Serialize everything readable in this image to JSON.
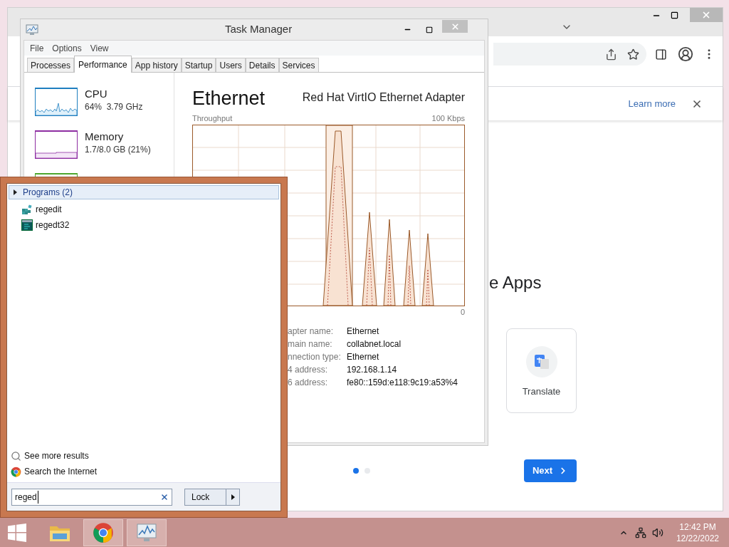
{
  "browser": {
    "infobar": {
      "link": "Learn more"
    },
    "heading": "e Apps",
    "app_card": {
      "label": "Translate"
    },
    "pager": [
      {
        "selected": true
      },
      {
        "selected": false
      }
    ],
    "next_button": "Next"
  },
  "task_manager": {
    "title": "Task Manager",
    "menu": [
      "File",
      "Options",
      "View"
    ],
    "tabs": [
      {
        "label": "Processes",
        "selected": false
      },
      {
        "label": "Performance",
        "selected": true
      },
      {
        "label": "App history",
        "selected": false
      },
      {
        "label": "Startup",
        "selected": false
      },
      {
        "label": "Users",
        "selected": false
      },
      {
        "label": "Details",
        "selected": false
      },
      {
        "label": "Services",
        "selected": false
      }
    ],
    "resources": [
      {
        "kind": "cpu",
        "name": "CPU",
        "detail": "64%  3.79 GHz",
        "color": "#1f7fc0"
      },
      {
        "kind": "memory",
        "name": "Memory",
        "detail": "1.7/8.0 GB (21%)",
        "color": "#8e2ea2"
      },
      {
        "kind": "disk",
        "color": "#4ea72e"
      }
    ],
    "detail": {
      "heading": "Ethernet",
      "adapter": "Red Hat VirtIO Ethernet Adapter",
      "graph_label": "Throughput",
      "graph_max": "100 Kbps",
      "graph_min": "0",
      "properties": [
        {
          "label": "apter name:",
          "value": "Ethernet"
        },
        {
          "label": "main name:",
          "value": "collabnet.local"
        },
        {
          "label": "nnection type:",
          "value": "Ethernet"
        },
        {
          "label": "4 address:",
          "value": "192.168.1.14"
        },
        {
          "label": "6 address:",
          "value": "fe80::159d:e118:9c19:a53%4"
        }
      ]
    }
  },
  "start_menu": {
    "group": "Programs (2)",
    "results": [
      {
        "kind": "regedit",
        "label": "regedit"
      },
      {
        "kind": "regedt32",
        "label": "regedt32"
      }
    ],
    "links": [
      {
        "kind": "search",
        "label": "See more results"
      },
      {
        "kind": "web",
        "label": "Search the Internet"
      }
    ],
    "search": {
      "value": "reged"
    },
    "power_button": "Lock"
  },
  "taskbar": {
    "apps": [
      {
        "kind": "explorer",
        "selected": false
      },
      {
        "kind": "chrome",
        "selected": true
      },
      {
        "kind": "taskmgr",
        "selected": true
      }
    ],
    "clock": {
      "time": "12:42 PM",
      "date": "12/22/2022"
    }
  }
}
